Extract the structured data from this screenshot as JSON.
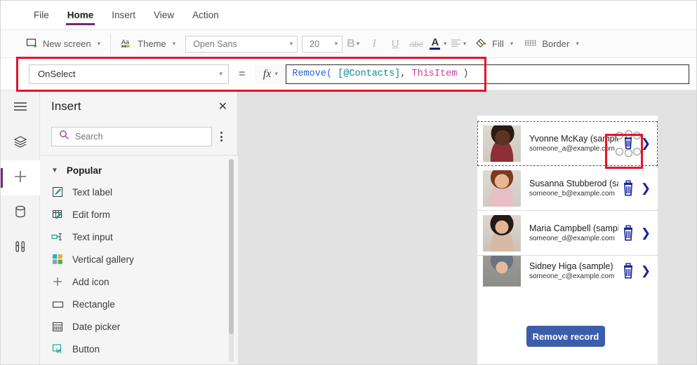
{
  "menu": {
    "items": [
      {
        "label": "File",
        "active": false
      },
      {
        "label": "Home",
        "active": true
      },
      {
        "label": "Insert",
        "active": false
      },
      {
        "label": "View",
        "active": false
      },
      {
        "label": "Action",
        "active": false
      }
    ]
  },
  "ribbon": {
    "new_screen": "New screen",
    "theme": "Theme",
    "font_name": "Open Sans",
    "font_size": "20",
    "bold": "B",
    "italic": "I",
    "underline": "U",
    "strikethrough": "abc",
    "font_color": "A",
    "align": "align",
    "fill": "Fill",
    "border": "Border"
  },
  "formula_bar": {
    "property": "OnSelect",
    "equals": "=",
    "fx": "fx",
    "formula_tokens": [
      {
        "text": "Remove(",
        "kind": "fn"
      },
      {
        "text": " ",
        "kind": "punc"
      },
      {
        "text": "[@Contacts]",
        "kind": "tbl"
      },
      {
        "text": ", ",
        "kind": "punc"
      },
      {
        "text": "ThisItem",
        "kind": "this"
      },
      {
        "text": " )",
        "kind": "punc"
      }
    ],
    "formula_plain": "Remove( [@Contacts], ThisItem )"
  },
  "rail": {
    "items": [
      {
        "name": "hamburger-menu-icon",
        "active": false
      },
      {
        "name": "tree-view-icon",
        "active": false
      },
      {
        "name": "insert-plus-icon",
        "active": true
      },
      {
        "name": "data-sources-icon",
        "active": false
      },
      {
        "name": "advanced-settings-icon",
        "active": false
      }
    ]
  },
  "insert_panel": {
    "title": "Insert",
    "close": "✕",
    "search_placeholder": "Search",
    "section": "Popular",
    "items": [
      {
        "label": "Text label",
        "icon": "text-label-icon"
      },
      {
        "label": "Edit form",
        "icon": "edit-form-icon"
      },
      {
        "label": "Text input",
        "icon": "text-input-icon"
      },
      {
        "label": "Vertical gallery",
        "icon": "vertical-gallery-icon"
      },
      {
        "label": "Add icon",
        "icon": "add-icon"
      },
      {
        "label": "Rectangle",
        "icon": "rectangle-icon"
      },
      {
        "label": "Date picker",
        "icon": "date-picker-icon"
      },
      {
        "label": "Button",
        "icon": "button-icon"
      }
    ]
  },
  "canvas": {
    "gallery": {
      "rows": [
        {
          "name": "Yvonne McKay (sample)",
          "email": "someone_a@example.com",
          "selected": true
        },
        {
          "name": "Susanna Stubberod (sample)",
          "email": "someone_b@example.com",
          "selected": false
        },
        {
          "name": "Maria Campbell (sample)",
          "email": "someone_d@example.com",
          "selected": false
        },
        {
          "name": "Sidney Higa (sample)",
          "email": "someone_c@example.com",
          "selected": false
        }
      ]
    },
    "remove_button": "Remove record"
  },
  "colors": {
    "accent_purple": "#742774",
    "highlight_red": "#e8112d",
    "button_blue": "#3b5dab",
    "icon_blue": "#16259c",
    "canvas_gray": "#e2e2e2"
  }
}
